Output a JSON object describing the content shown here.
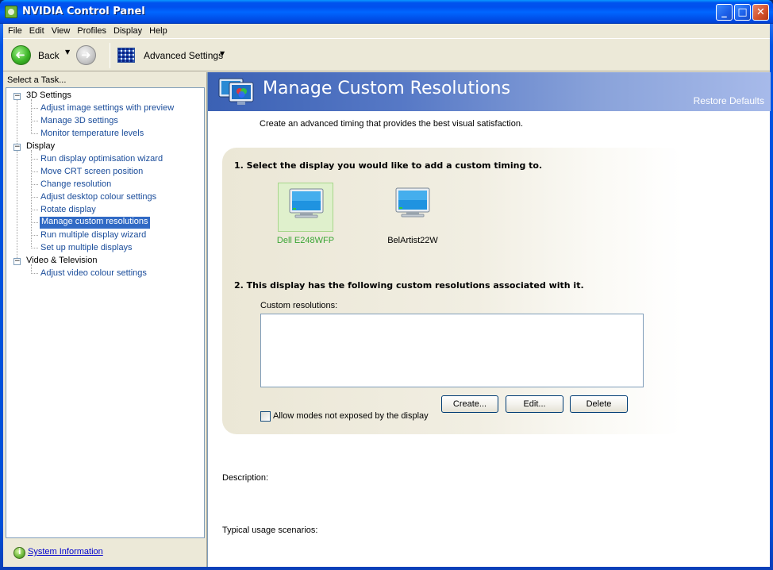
{
  "window": {
    "title": "NVIDIA Control Panel"
  },
  "menu": {
    "items": [
      "File",
      "Edit",
      "View",
      "Profiles",
      "Display",
      "Help"
    ]
  },
  "toolbar": {
    "back_label": "Back",
    "advanced_label": "Advanced Settings"
  },
  "sidebar": {
    "task_label": "Select a Task...",
    "categories": [
      {
        "label": "3D Settings",
        "items": [
          "Adjust image settings with preview",
          "Manage 3D settings",
          "Monitor temperature levels"
        ]
      },
      {
        "label": "Display",
        "items": [
          "Run display optimisation wizard",
          "Move CRT screen position",
          "Change resolution",
          "Adjust desktop colour settings",
          "Rotate display",
          "Manage custom resolutions",
          "Run multiple display wizard",
          "Set up multiple displays"
        ]
      },
      {
        "label": "Video & Television",
        "items": [
          "Adjust video colour settings"
        ]
      }
    ],
    "selected_item": "Manage custom resolutions",
    "system_info": "System Information"
  },
  "main": {
    "title": "Manage Custom Resolutions",
    "restore_defaults": "Restore Defaults",
    "subtitle": "Create an advanced timing that provides the best visual satisfaction.",
    "step1": "1. Select the display you would like to add a custom timing to.",
    "displays": [
      {
        "label": "Dell E248WFP",
        "selected": true
      },
      {
        "label": "BelArtist22W",
        "selected": false
      }
    ],
    "step2": "2. This display has the following custom resolutions associated with it.",
    "custom_resolutions_label": "Custom resolutions:",
    "buttons": {
      "create": "Create...",
      "edit": "Edit...",
      "delete": "Delete"
    },
    "allow_modes_label": "Allow modes not exposed by the display",
    "allow_modes_checked": false,
    "description_label": "Description:",
    "usage_label": "Typical usage scenarios:"
  },
  "colors": {
    "selection": "#316ac5",
    "link": "#1a4c9a",
    "selected_display_text": "#3aa535"
  }
}
